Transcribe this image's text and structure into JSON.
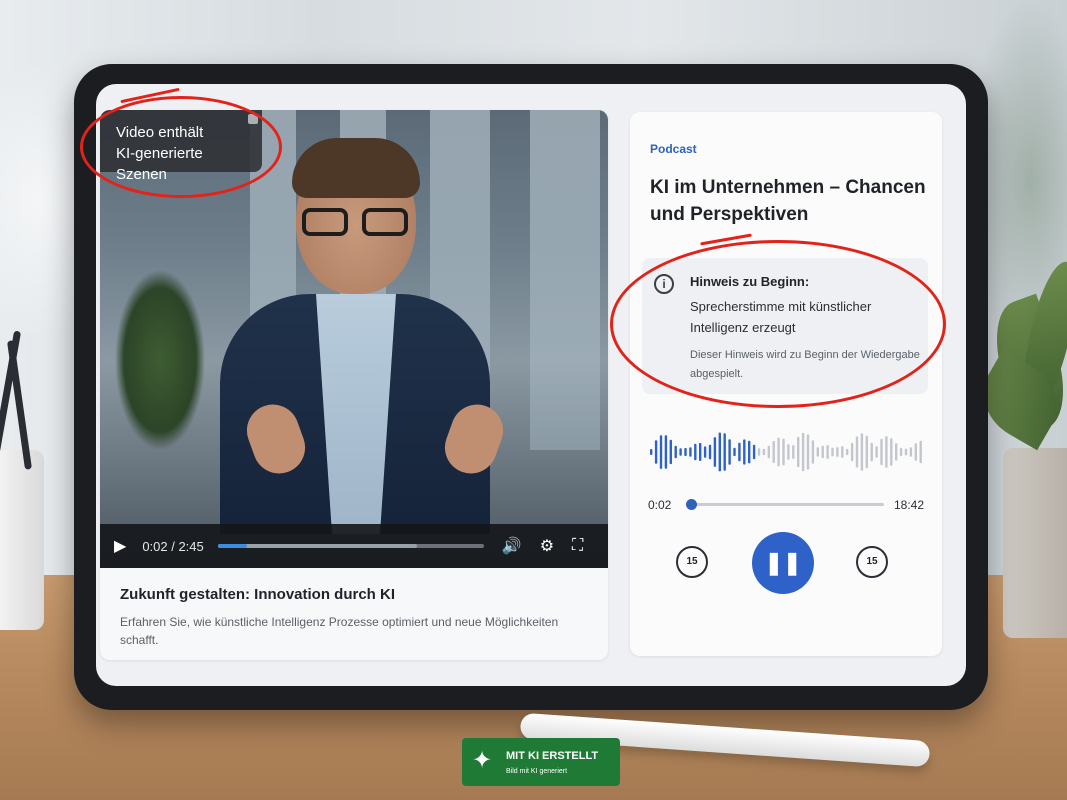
{
  "video": {
    "badge_line1": "Video enthält",
    "badge_line2": "KI-generierte Szenen",
    "current_time": "0:02 / 2:45",
    "progress": 0.11,
    "buffered": 0.75,
    "title": "Zukunft gestalten: Innovation durch KI",
    "description": "Erfahren Sie, wie künstliche Intelligenz Prozesse optimiert und neue Möglichkeiten schafft."
  },
  "podcast": {
    "label": "Podcast",
    "title": "KI im Unternehmen – Chancen und Perspektiven",
    "notice_heading": "Hinweis zu Beginn:",
    "notice_text": "Sprecherstimme mit künstlicher Intelligenz erzeugt",
    "notice_sub": "Dieser Hinweis wird zu Beginn der Wiedergabe abgespielt.",
    "time_start": "0:02",
    "time_end": "18:42",
    "skip_back": "15",
    "skip_forward": "15",
    "progress": 0.0
  },
  "ai_label": {
    "title": "MIT KI ERSTELLT",
    "subtitle": "Bild mit KI generiert"
  },
  "colors": {
    "accent_blue": "#2f62c8",
    "annotation_red": "#e2231a",
    "label_green": "#1f7a35"
  },
  "icons": {
    "play": "play-icon",
    "volume": "volume-icon",
    "settings": "gear-icon",
    "fullscreen": "fullscreen-icon",
    "info": "info-icon",
    "pause": "pause-icon",
    "rewind": "rewind-15-icon",
    "forward": "forward-15-icon",
    "sparkle": "sparkle-icon"
  }
}
